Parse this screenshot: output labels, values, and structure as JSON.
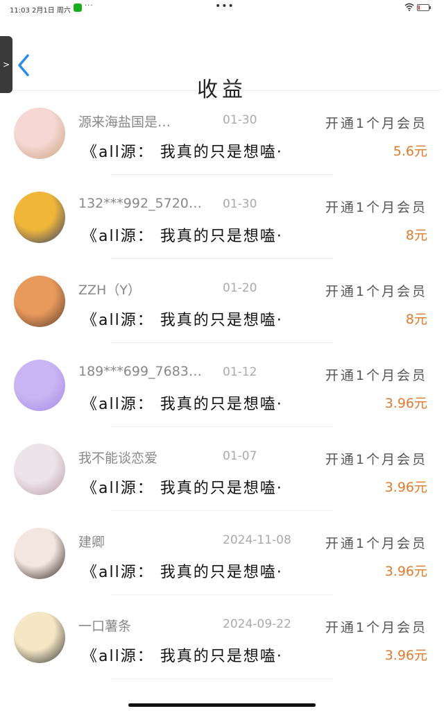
{
  "status": {
    "time": "11:03  2月1日 周六",
    "dots_left": "···",
    "dots_center": "•••",
    "wifi": "WiFi",
    "battery_level": 0.15
  },
  "header": {
    "back_label": "‹",
    "title": "收益"
  },
  "side_handle": ">",
  "rows": [
    {
      "name": "源来海盐国是…",
      "date": "01-30",
      "type": "开通1个月会员",
      "book": "《all源： 我真的只是想嗑·",
      "amount": "5.6元",
      "avatar_color": [
        "#f6d7d3",
        "#c8a27b"
      ]
    },
    {
      "name": "132***992_57206…",
      "date": "01-30",
      "type": "开通1个月会员",
      "book": "《all源： 我真的只是想嗑·",
      "amount": "8元",
      "avatar_color": [
        "#f0b63a",
        "#2b3a6b"
      ]
    },
    {
      "name": "ZZH（Y）",
      "date": "01-20",
      "type": "开通1个月会员",
      "book": "《all源： 我真的只是想嗑·",
      "amount": "8元",
      "avatar_color": [
        "#e89a5c",
        "#5a3a2b"
      ]
    },
    {
      "name": "189***699_76839…",
      "date": "01-12",
      "type": "开通1个月会员",
      "book": "《all源： 我真的只是想嗑·",
      "amount": "3.96元",
      "avatar_color": [
        "#c9b5f3",
        "#a489e6"
      ]
    },
    {
      "name": "我不能谈恋爱",
      "date": "01-07",
      "type": "开通1个月会员",
      "book": "《all源： 我真的只是想嗑·",
      "amount": "3.96元",
      "avatar_color": [
        "#ece4e8",
        "#b99aa6"
      ]
    },
    {
      "name": "建卿",
      "date": "2024-11-08",
      "type": "开通1个月会员",
      "book": "《all源： 我真的只是想嗑·",
      "amount": "3.96元",
      "avatar_color": [
        "#f3e6e0",
        "#2a1c18"
      ]
    },
    {
      "name": "一口薯条",
      "date": "2024-09-22",
      "type": "开通1个月会员",
      "book": "《all源： 我真的只是想嗑·",
      "amount": "3.96元",
      "avatar_color": [
        "#f5e7c5",
        "#2d2d2d"
      ]
    }
  ]
}
